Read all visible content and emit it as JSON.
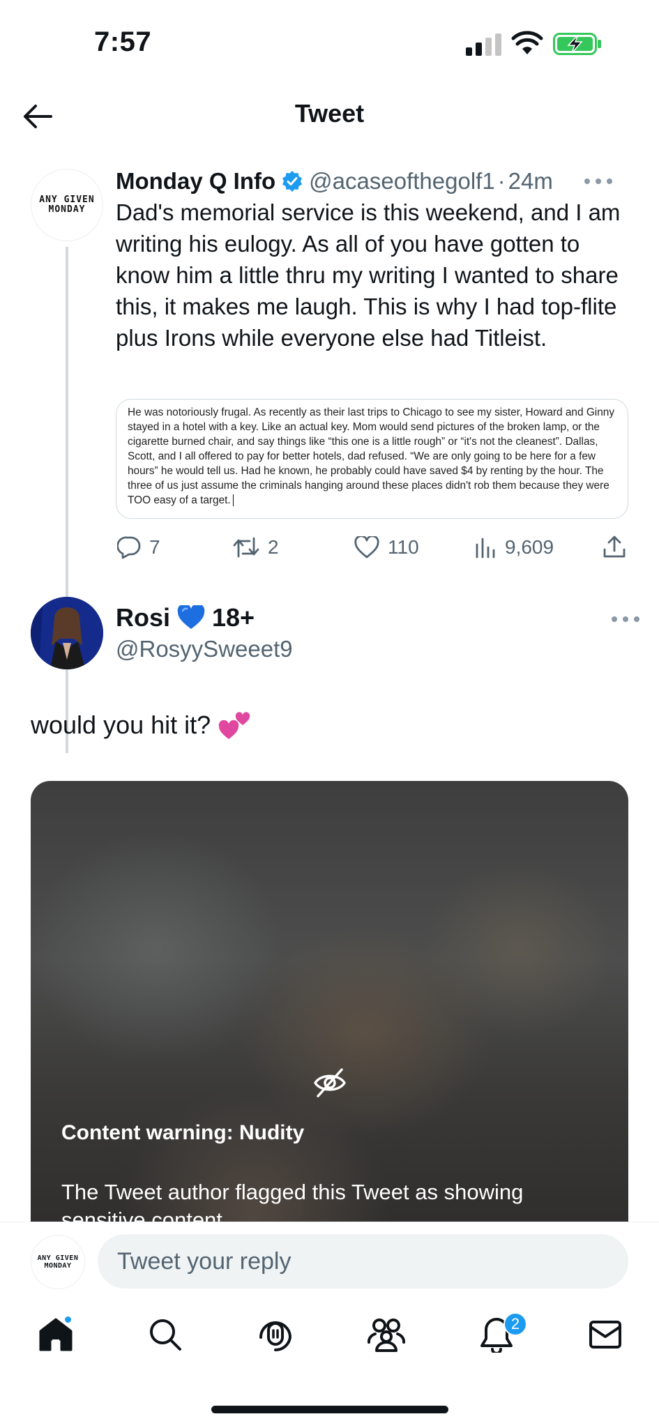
{
  "status_bar": {
    "time": "7:57",
    "icons": [
      "cellular-signal-icon",
      "wifi-icon",
      "battery-charging-icon"
    ],
    "battery_color": "#34c759"
  },
  "header": {
    "title": "Tweet",
    "back_icon": "arrow-left-icon"
  },
  "tweet_main": {
    "avatar_text_line1": "ANY GIVEN",
    "avatar_text_line2": "MONDAY",
    "name": "Monday Q Info",
    "verified": true,
    "handle": "@acaseofthegolf1",
    "separator": "·",
    "time_ago": "24m",
    "text": "Dad's memorial service is this weekend, and I am writing his eulogy. As all of you have gotten to know him a little thru my writing I wanted to share this, it makes me laugh. This is why I had top-flite plus Irons while everyone else had Titleist.",
    "quote_image_text": "He was notoriously frugal. As recently as their last trips to Chicago to see my sister, Howard and Ginny stayed in a hotel with a key. Like an actual key. Mom would send pictures of the broken lamp, or the cigarette burned chair, and say things like “this one is a little rough” or “it's not the cleanest”. Dallas, Scott, and I all offered to pay for better hotels, dad refused. “We are only going to be here for a few hours” he would tell us.  Had he known, he probably could have saved $4 by renting by the hour. The three of us just assume the criminals hanging around these places didn't rob them because they were TOO easy of a target.",
    "stats": {
      "replies": "7",
      "retweets": "2",
      "likes": "110",
      "views": "9,609"
    }
  },
  "tweet_reply": {
    "name": "Rosi",
    "badge": "18+",
    "handle": "@RosyySweeet9",
    "text": "would you hit it?",
    "content_warning_title": "Content warning: Nudity",
    "content_warning_desc": "The Tweet author flagged this Tweet as showing sensitive content."
  },
  "reply_bar": {
    "avatar_text_line1": "ANY GIVEN",
    "avatar_text_line2": "MONDAY",
    "placeholder": "Tweet your reply"
  },
  "tab_bar": {
    "tabs": [
      "home-icon",
      "search-icon",
      "spaces-icon",
      "communities-icon",
      "notifications-icon",
      "messages-icon"
    ],
    "notifications_count": "2"
  },
  "colors": {
    "accent": "#1d9bf0",
    "secondary_text": "#536471",
    "heart_blue": "#1d6fe0"
  }
}
